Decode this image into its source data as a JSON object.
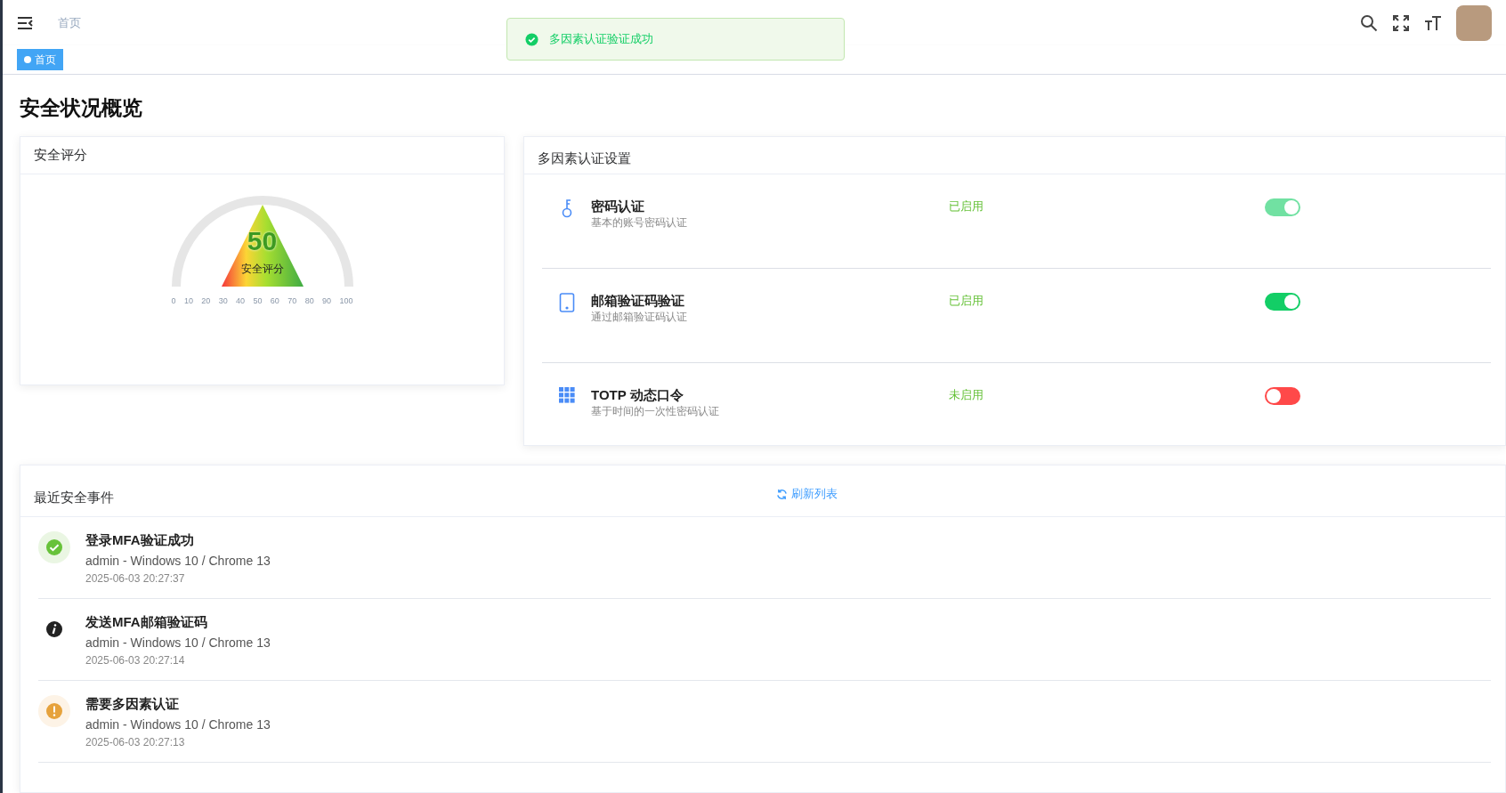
{
  "header": {
    "breadcrumb": "首页"
  },
  "toast": {
    "kind": "success",
    "text": "多因素认证验证成功"
  },
  "tags": [
    {
      "label": "首页",
      "selected": true
    }
  ],
  "page_title": "安全状况概览",
  "score_card": {
    "title": "安全评分",
    "score": "50",
    "label": "安全评分",
    "ticks": [
      "0",
      "10",
      "20",
      "30",
      "40",
      "50",
      "60",
      "70",
      "80",
      "90",
      "100"
    ]
  },
  "mfa_card": {
    "title": "多因素认证设置",
    "methods": [
      {
        "kind": "password",
        "name": "密码认证",
        "description": "基本的账号密码认证",
        "status": "已启用",
        "on": true,
        "disabled": true
      },
      {
        "kind": "email",
        "name": "邮箱验证码验证",
        "description": "通过邮箱验证码认证",
        "status": "已启用",
        "on": true,
        "disabled": false
      },
      {
        "kind": "totp",
        "name": "TOTP 动态口令",
        "description": "基于时间的一次性密码认证",
        "status": "未启用",
        "on": false,
        "disabled": false
      }
    ]
  },
  "events_card": {
    "title": "最近安全事件",
    "refresh": "刷新列表",
    "events": [
      {
        "kind": "success",
        "title": "登录MFA验证成功",
        "detail": "admin - Windows 10 / Chrome 13",
        "time": "2025-06-03 20:27:37"
      },
      {
        "kind": "info",
        "title": "发送MFA邮箱验证码",
        "detail": "admin - Windows 10 / Chrome 13",
        "time": "2025-06-03 20:27:14"
      },
      {
        "kind": "warning",
        "title": "需要多因素认证",
        "detail": "admin - Windows 10 / Chrome 13",
        "time": "2025-06-03 20:27:13"
      }
    ]
  }
}
